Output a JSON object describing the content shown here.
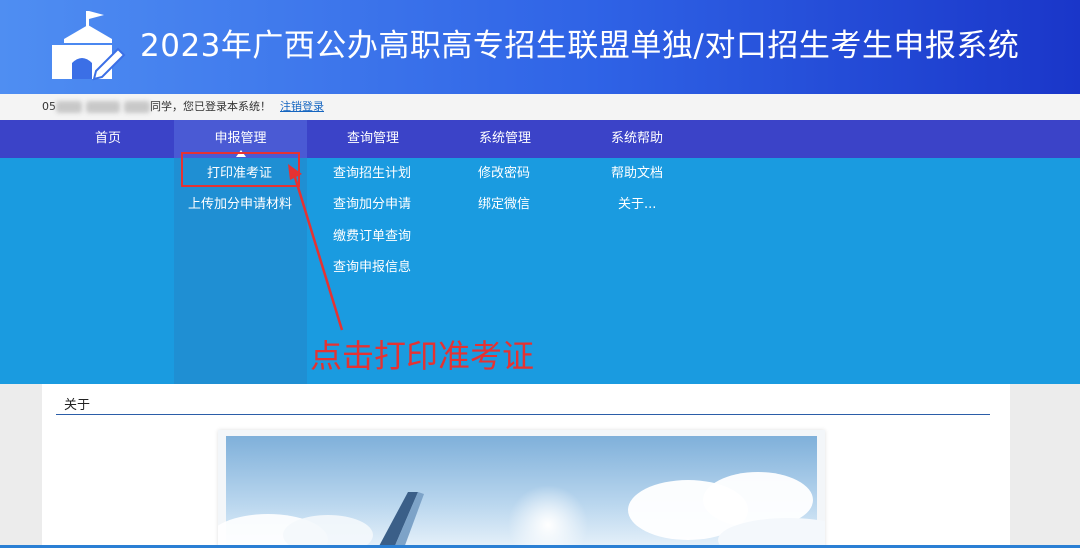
{
  "header": {
    "title": "2023年广西公办高职高专招生联盟单独/对口招生考生申报系统",
    "logo_icon": "school-building-icon"
  },
  "login_bar": {
    "id_prefix": "05",
    "greeting": "同学，您已登录本系统！",
    "logout_label": "注销登录"
  },
  "nav": {
    "items": [
      {
        "label": "首页"
      },
      {
        "label": "申报管理"
      },
      {
        "label": "查询管理"
      },
      {
        "label": "系统管理"
      },
      {
        "label": "系统帮助"
      }
    ],
    "active_index": 1
  },
  "dropdown": {
    "shenbao": [
      "打印准考证",
      "上传加分申请材料"
    ],
    "chaxun": [
      "查询招生计划",
      "查询加分申请",
      "缴费订单查询",
      "查询申报信息"
    ],
    "xitong": [
      "修改密码",
      "绑定微信"
    ],
    "bangzhu": [
      "帮助文档",
      "关于..."
    ]
  },
  "annotation": {
    "text": "点击打印准考证",
    "color": "#e53232"
  },
  "content": {
    "section_title": "关于"
  },
  "colors": {
    "nav_bg": "#3b43c8",
    "dropdown_bg": "#1a9be0",
    "banner_start": "#4f8ef2",
    "banner_end": "#1a36c9"
  }
}
